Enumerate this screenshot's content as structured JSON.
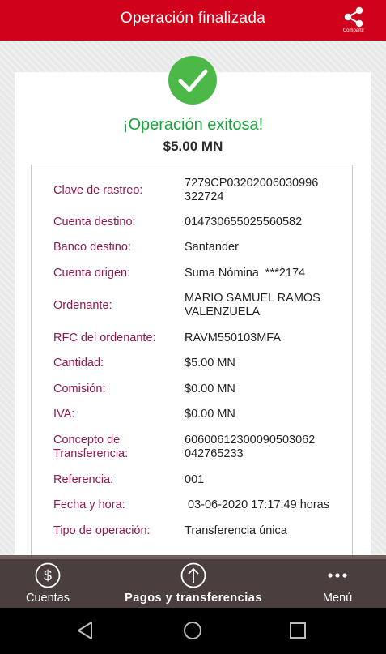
{
  "header": {
    "title": "Operación finalizada",
    "share_label": "Compartir"
  },
  "status": {
    "message": "¡Operación exitosa!",
    "amount": "$5.00 MN",
    "accent_green": "#4cb848"
  },
  "details": [
    {
      "label": "Clave de rastreo:",
      "value": "7279CP03202006030996\n322724"
    },
    {
      "label": "Cuenta destino:",
      "value": "014730655025560582"
    },
    {
      "label": "Banco destino:",
      "value": "Santander"
    },
    {
      "label": "Cuenta origen:",
      "value": "Suma Nómina  ***2174"
    },
    {
      "label": "Ordenante:",
      "value": "MARIO SAMUEL RAMOS\nVALENZUELA"
    },
    {
      "label": "RFC del ordenante:",
      "value": "RAVM550103MFA"
    },
    {
      "label": "Cantidad:",
      "value": "$5.00 MN"
    },
    {
      "label": "Comisión:",
      "value": "$0.00 MN"
    },
    {
      "label": "IVA:",
      "value": "$0.00 MN"
    },
    {
      "label": "Concepto de\nTransferencia:",
      "value": "60600612300090503062\n042765233"
    },
    {
      "label": "Referencia:",
      "value": "001"
    },
    {
      "label": "Fecha y hora:",
      "value": " 03-06-2020 17:17:49 horas"
    },
    {
      "label": "Tipo de operación:",
      "value": "Transferencia única"
    }
  ],
  "bottom_nav": [
    {
      "label": "Cuentas",
      "icon": "dollar-circle-icon"
    },
    {
      "label": "Pagos y transferencias",
      "icon": "arrow-up-circle-icon"
    },
    {
      "label": "Menú",
      "icon": "more-dots-icon"
    }
  ],
  "colors": {
    "brand_red": "#d0021b",
    "label_color": "#8c1b4e",
    "nav_bg": "#4a3e3f"
  },
  "system_nav": [
    "back-icon",
    "home-icon",
    "recents-icon"
  ]
}
